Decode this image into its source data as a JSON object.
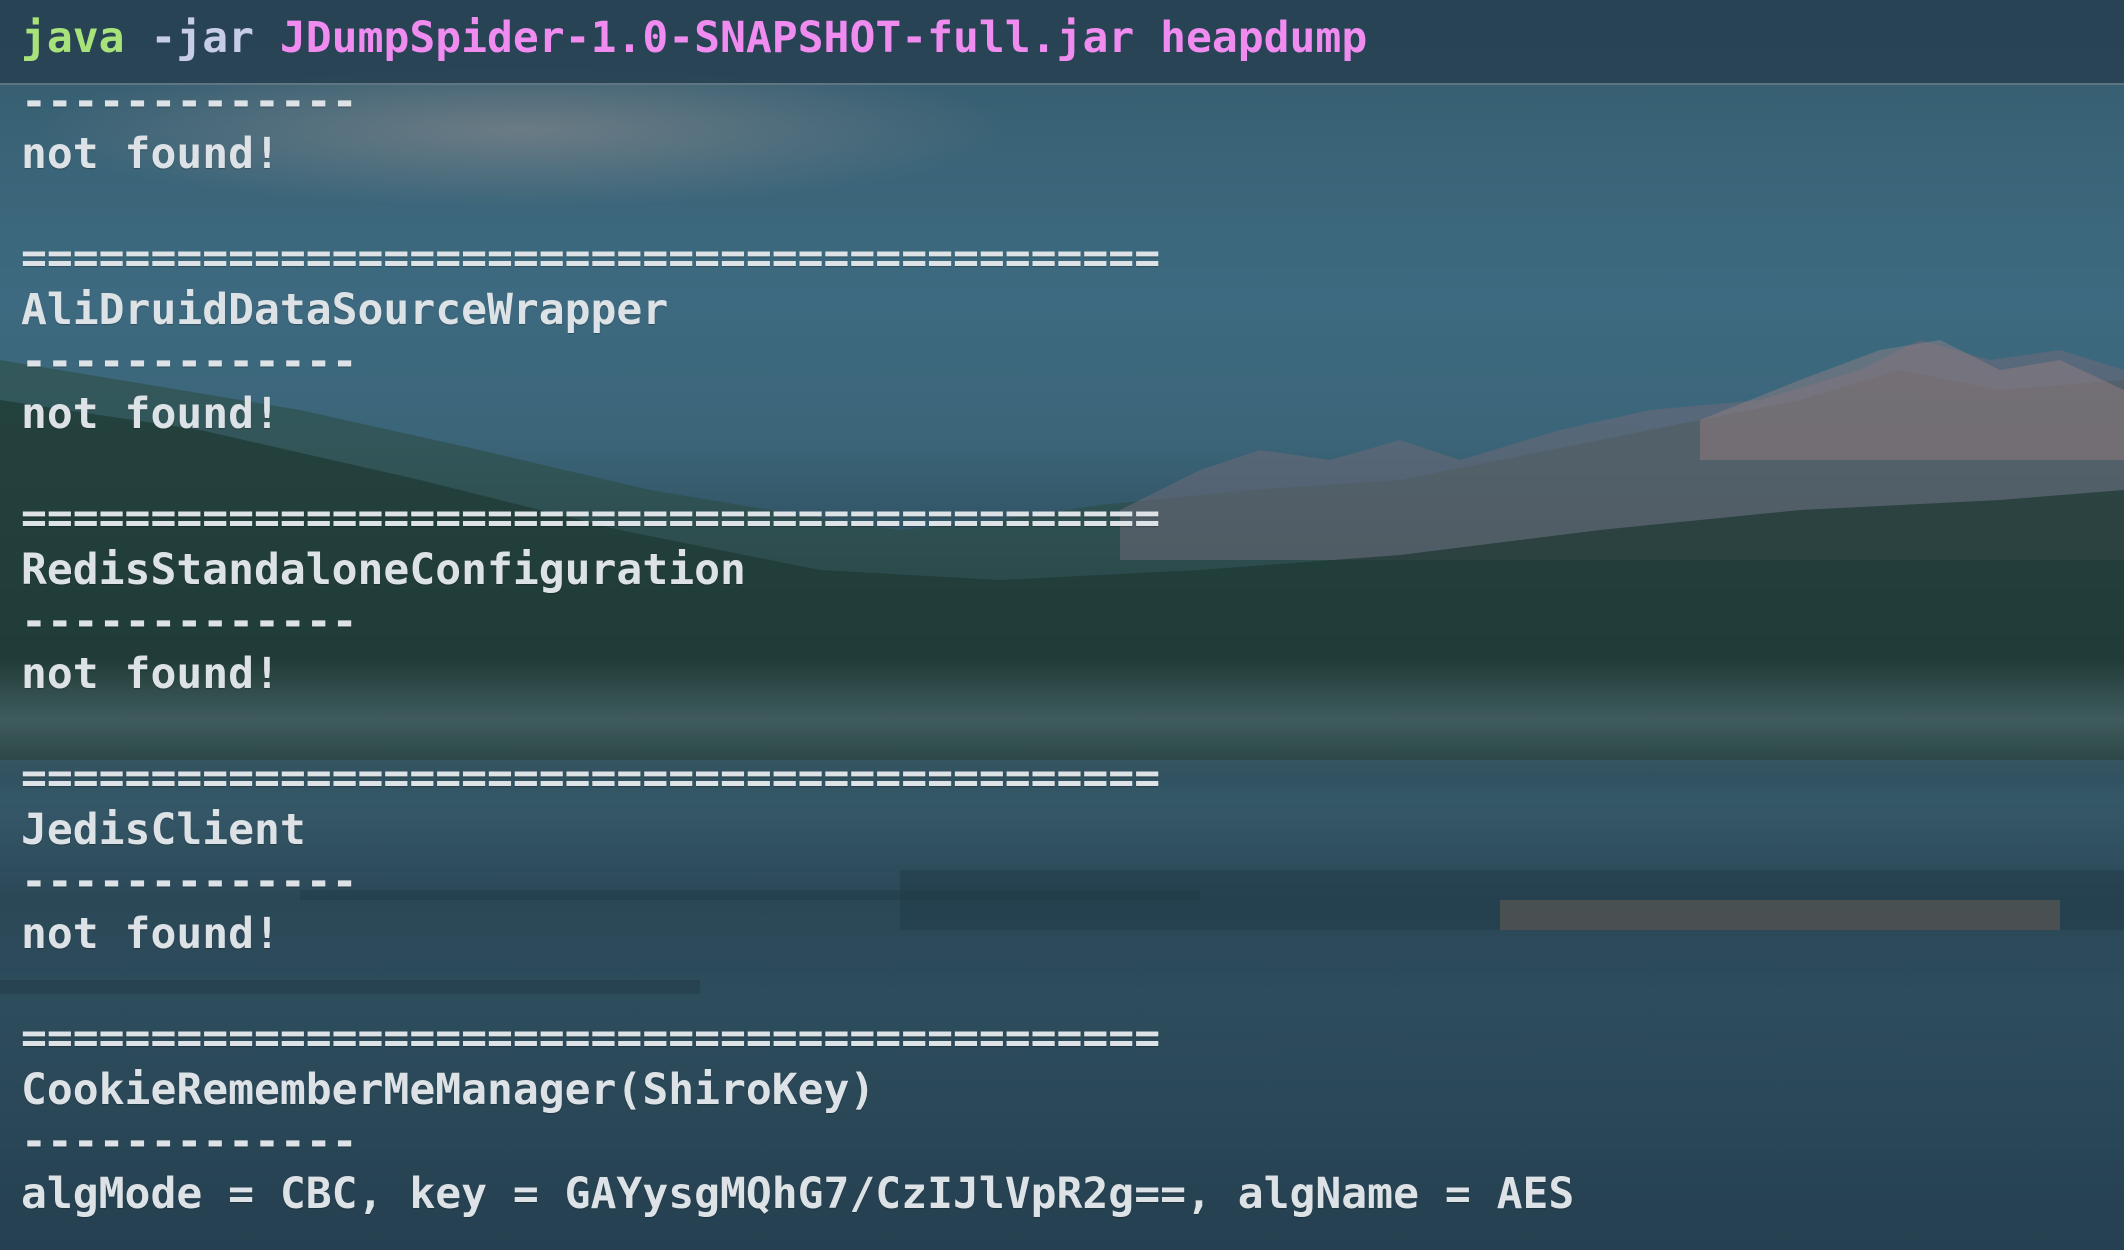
{
  "terminal": {
    "command": {
      "program": "java",
      "flag": "-jar",
      "args": "JDumpSpider-1.0-SNAPSHOT-full.jar heapdump"
    },
    "lines": [
      "-------------",
      "not found!",
      "",
      "============================================",
      "AliDruidDataSourceWrapper",
      "-------------",
      "not found!",
      "",
      "============================================",
      "RedisStandaloneConfiguration",
      "-------------",
      "not found!",
      "",
      "============================================",
      "JedisClient",
      "-------------",
      "not found!",
      "",
      "============================================",
      "CookieRememberMeManager(ShiroKey)",
      "-------------",
      "algMode = CBC, key = GAYysgMQhG7/CzIJlVpR2g==, algName = AES"
    ]
  },
  "colors": {
    "command_keyword": "#a8e27a",
    "command_flag": "#c7cde6",
    "command_args": "#f08bf0",
    "output_text": "#dde2e6"
  },
  "background": "mountain-lake-wallpaper"
}
